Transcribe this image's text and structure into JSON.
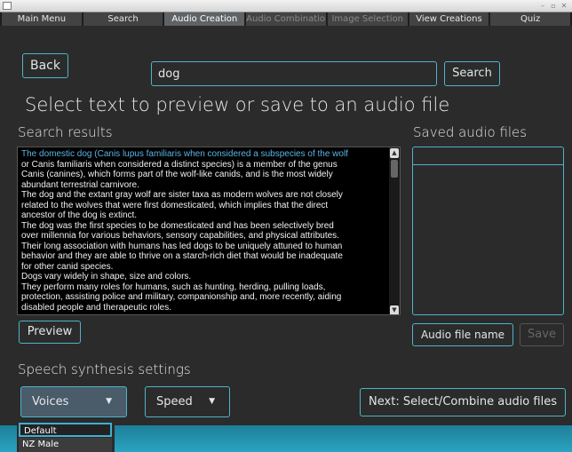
{
  "tabs": [
    {
      "label": "Main Menu",
      "state": "normal"
    },
    {
      "label": "Search",
      "state": "normal"
    },
    {
      "label": "Audio Creation",
      "state": "active"
    },
    {
      "label": "Audio Combination",
      "state": "disabled"
    },
    {
      "label": "Image Selection",
      "state": "disabled"
    },
    {
      "label": "View Creations",
      "state": "normal"
    },
    {
      "label": "Quiz",
      "state": "normal"
    }
  ],
  "toolbar": {
    "back_label": "Back",
    "search_value": "dog",
    "search_label": "Search"
  },
  "page_title": "Select text to preview or save to an audio file",
  "results": {
    "heading": "Search results",
    "selected_text": "The domestic dog (Canis lupus familiaris when considered a subspecies of the wolf",
    "lines": [
      "or Canis familiaris when considered a distinct species) is a member of the genus",
      "Canis (canines), which forms part of the wolf-like canids, and is the most widely",
      "abundant terrestrial carnivore.",
      "The dog and the extant gray wolf are sister taxa as modern wolves are not closely",
      "related to the wolves that were first domesticated, which implies that the direct",
      "ancestor of the dog is extinct.",
      "The dog was the first species to be domesticated and has been selectively bred",
      "over millennia for various behaviors, sensory capabilities, and physical attributes.",
      "Their long association with humans has led dogs to be uniquely attuned to human",
      "behavior and they are able to thrive on a starch-rich diet that would be inadequate",
      "for other canid species.",
      "Dogs vary widely in shape, size and colors.",
      "They perform many roles for humans, such as hunting, herding, pulling loads,",
      "protection, assisting police and military, companionship and, more recently, aiding",
      "disabled people and therapeutic roles."
    ],
    "preview_label": "Preview"
  },
  "saved": {
    "heading": "Saved audio files",
    "name_label": "Audio file name",
    "save_label": "Save"
  },
  "speech": {
    "heading": "Speech synthesis settings",
    "voices_label": "Voices",
    "speed_label": "Speed",
    "next_label": "Next: Select/Combine audio files",
    "voice_options": [
      "Default",
      "NZ Male"
    ]
  },
  "colors": {
    "accent": "#4fb3c9",
    "selected_text": "#5ab4e6",
    "active_tab": "#5f6366"
  }
}
